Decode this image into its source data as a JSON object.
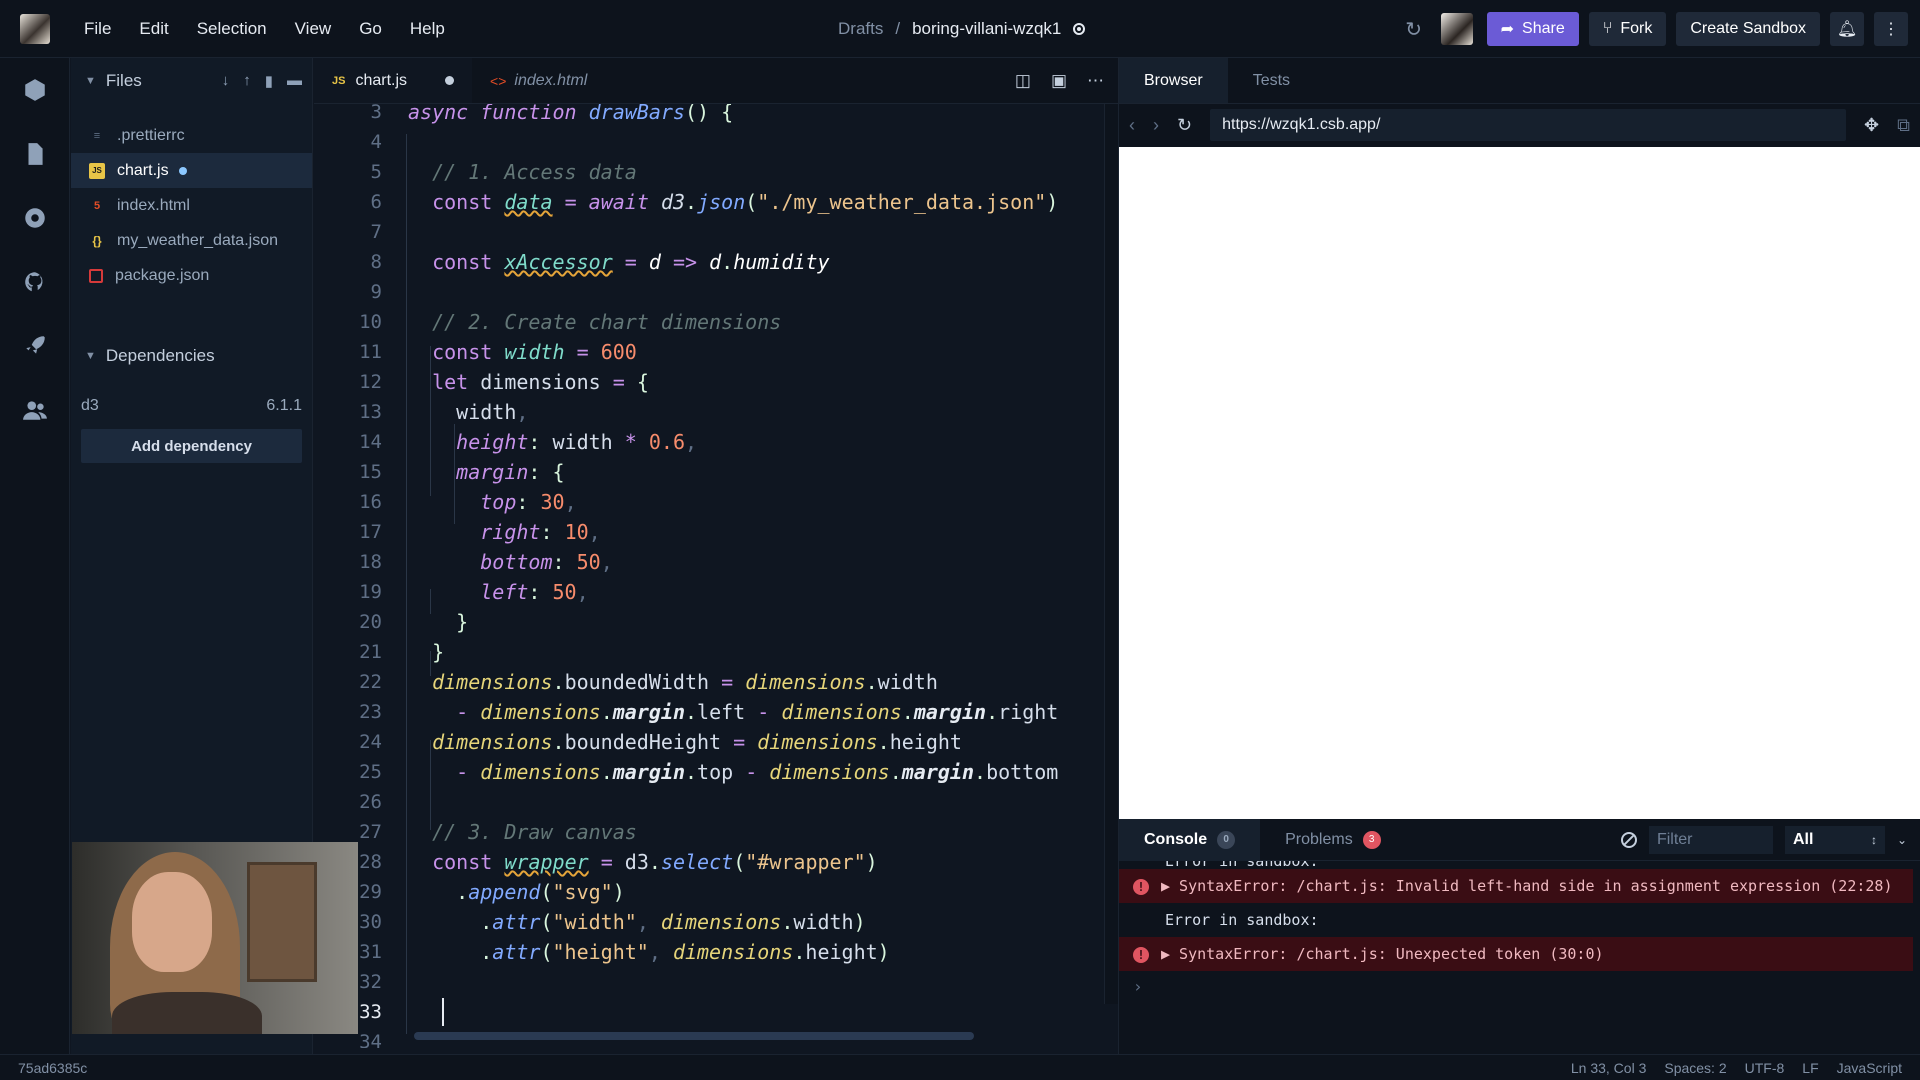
{
  "menu": [
    "File",
    "Edit",
    "Selection",
    "View",
    "Go",
    "Help"
  ],
  "breadcrumb": {
    "folder": "Drafts",
    "separator": "/",
    "name": "boring-villani-wzqk1"
  },
  "actions": {
    "share": "Share",
    "fork": "Fork",
    "create": "Create Sandbox"
  },
  "sidebar": {
    "files_title": "Files",
    "files": [
      {
        "name": ".prettierrc",
        "icon": "prettier-file-icon"
      },
      {
        "name": "chart.js",
        "icon": "js-file-icon",
        "active": true,
        "modified": true
      },
      {
        "name": "index.html",
        "icon": "html-file-icon"
      },
      {
        "name": "my_weather_data.json",
        "icon": "json-file-icon"
      },
      {
        "name": "package.json",
        "icon": "npm-file-icon"
      }
    ],
    "deps_title": "Dependencies",
    "dependency": {
      "name": "d3",
      "version": "6.1.1"
    },
    "add_dependency": "Add dependency"
  },
  "editor": {
    "tabs": [
      {
        "label": "chart.js",
        "icon": "JS"
      },
      {
        "label": "index.html",
        "icon": "<>"
      }
    ]
  },
  "code": {
    "line_numbers": [
      "3",
      "4",
      "5",
      "6",
      "7",
      "8",
      "9",
      "10",
      "11",
      "12",
      "13",
      "14",
      "15",
      "16",
      "17",
      "18",
      "19",
      "20",
      "21",
      "22",
      "23",
      "24",
      "25",
      "26",
      "27",
      "28",
      "29",
      "30",
      "31",
      "32",
      "33",
      "34"
    ],
    "current_line": "33"
  },
  "browser": {
    "tabs": [
      "Browser",
      "Tests"
    ],
    "url": "https://wzqk1.csb.app/"
  },
  "console": {
    "tabs": [
      {
        "label": "Console",
        "count": "0"
      },
      {
        "label": "Problems",
        "count": "3"
      }
    ],
    "filter_placeholder": "Filter",
    "level": "All",
    "clipped": "Error in sandbox:",
    "entries": [
      {
        "type": "error",
        "text": "▶ SyntaxError: /chart.js: Invalid left-hand side in assignment expression (22:28)"
      },
      {
        "type": "info",
        "text": "Error in sandbox:"
      },
      {
        "type": "error",
        "text": "▶ SyntaxError: /chart.js: Unexpected token (30:0)"
      }
    ],
    "prompt": "›"
  },
  "status": {
    "hash": "75ad6385c",
    "position": "Ln 33, Col 3",
    "spaces": "Spaces: 2",
    "encoding": "UTF-8",
    "eol": "LF",
    "language": "JavaScript"
  },
  "colors": {
    "share": "#6b5bd6",
    "error_bg": "#3a0d14",
    "badge_red": "#e05561"
  }
}
